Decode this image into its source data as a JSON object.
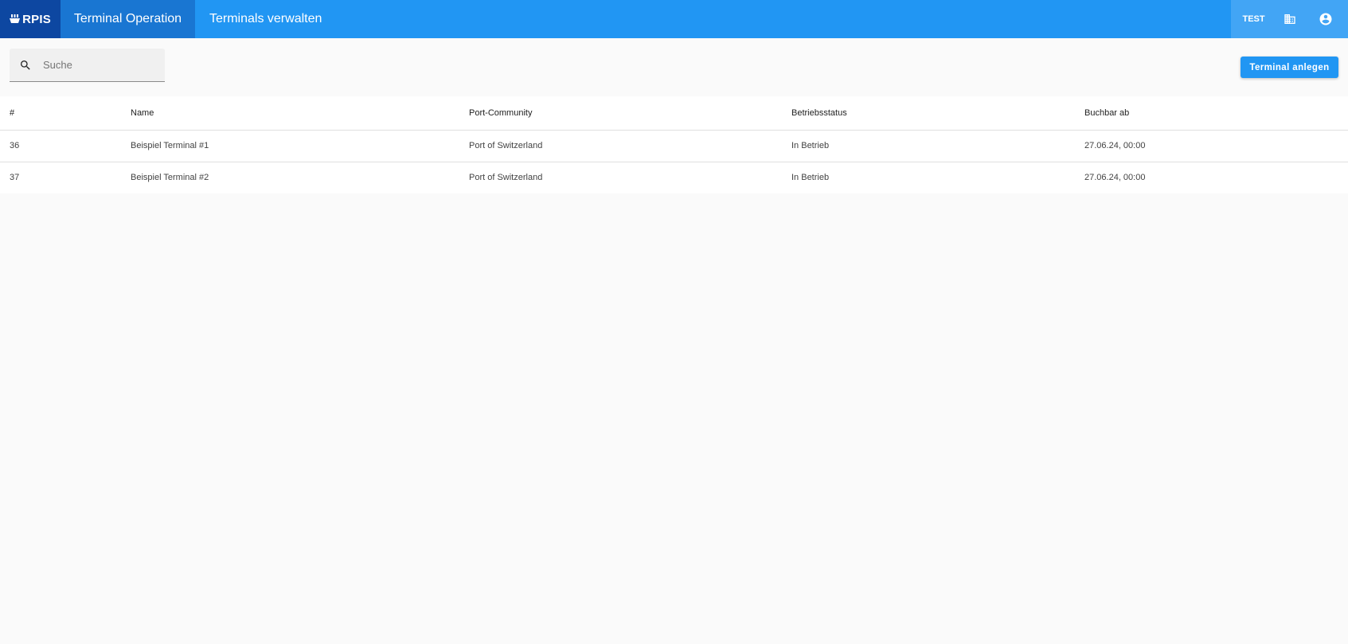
{
  "header": {
    "logo_text": "RPIS",
    "tabs": [
      {
        "label": "Terminal Operation",
        "active": true
      },
      {
        "label": "Terminals verwalten",
        "active": false
      }
    ],
    "env_label": "TEST",
    "icons": [
      "building-icon",
      "account-circle-icon"
    ],
    "colors": {
      "appbar": "#2196f3",
      "logo_bg": "#0d47a1",
      "active_tab": "#1976d2",
      "right_block": "#42a5f5"
    }
  },
  "toolbar": {
    "search": {
      "placeholder": "Suche",
      "value": ""
    },
    "create_button_label": "Terminal anlegen"
  },
  "table": {
    "columns": [
      "#",
      "Name",
      "Port-Community",
      "Betriebsstatus",
      "Buchbar ab"
    ],
    "rows": [
      [
        "36",
        "Beispiel Terminal #1",
        "Port of Switzerland",
        "In Betrieb",
        "27.06.24, 00:00"
      ],
      [
        "37",
        "Beispiel Terminal #2",
        "Port of Switzerland",
        "In Betrieb",
        "27.06.24, 00:00"
      ]
    ]
  }
}
